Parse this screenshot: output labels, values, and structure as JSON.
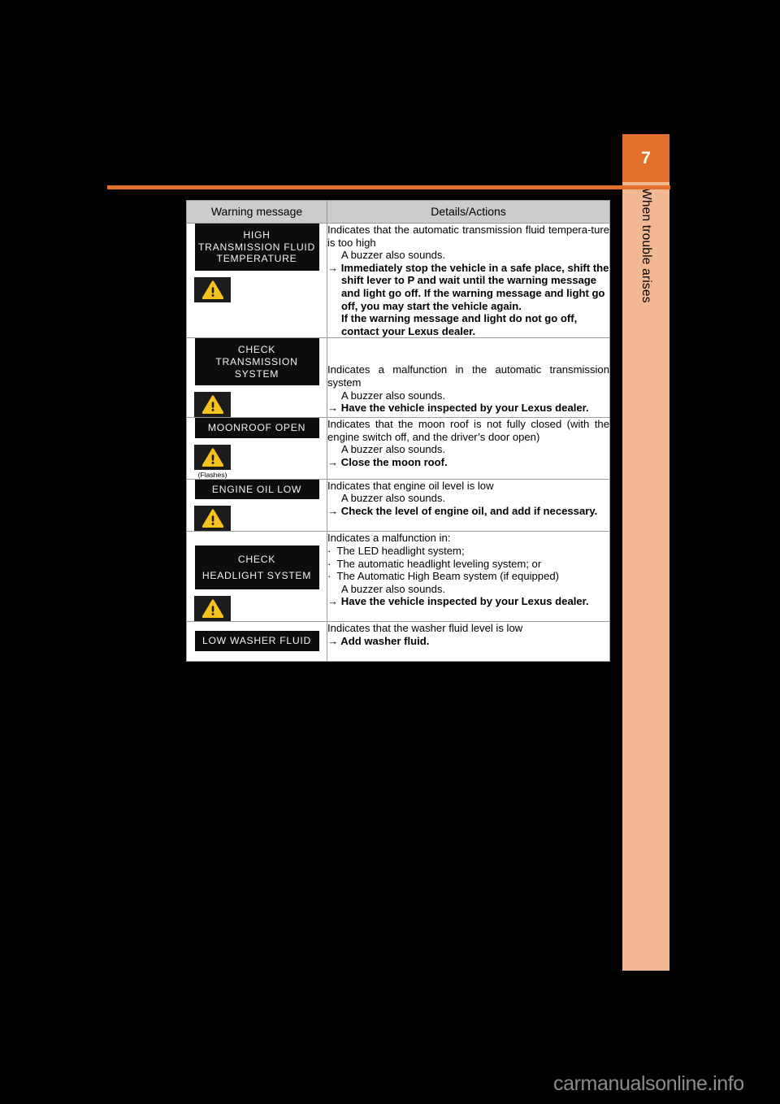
{
  "page": {
    "background_color": "#000000",
    "accent_color": "#e2702a",
    "tab_color": "#f2b894"
  },
  "side_tab": {
    "chapter_number": "7",
    "chapter_label": "When trouble arises"
  },
  "table": {
    "headers": {
      "warning_message": "Warning message",
      "details_actions": "Details/Actions"
    },
    "rows": [
      {
        "display_lines": [
          "HIGH",
          "TRANSMISSION FLUID",
          "TEMPERATURE"
        ],
        "lamp": "warning-triangle-icon",
        "flashes_note": "",
        "description": "Indicates that the automatic transmission fluid tempera-ture is too high",
        "buzzer": "A buzzer also sounds.",
        "arrow": "→",
        "action": "Immediately stop the vehicle in a safe place, shift the shift lever to P and wait until the warning message and light go off. If the warning message and light go off, you may start the vehicle again.",
        "action_extra": "If the warning message and light do not go off, contact your Lexus dealer.",
        "bullets": []
      },
      {
        "display_lines": [
          "CHECK",
          "TRANSMISSION",
          "SYSTEM"
        ],
        "lamp": "warning-triangle-icon",
        "flashes_note": "",
        "description": "Indicates a malfunction in the automatic transmission system",
        "buzzer": "A buzzer also sounds.",
        "arrow": "→",
        "action": "Have the vehicle inspected by your Lexus dealer.",
        "action_extra": "",
        "bullets": []
      },
      {
        "display_lines": [
          "MOONROOF OPEN"
        ],
        "lamp": "warning-triangle-icon",
        "flashes_note": "(Flashes)",
        "description": "Indicates that the moon roof is not fully closed (with the engine switch off, and the driver’s door open)",
        "buzzer": "A buzzer also sounds.",
        "arrow": "→",
        "action": "Close the moon roof.",
        "action_extra": "",
        "bullets": []
      },
      {
        "display_lines": [
          "ENGINE OIL LOW"
        ],
        "lamp": "warning-triangle-icon",
        "flashes_note": "",
        "description": "Indicates that engine oil level is low",
        "buzzer": "A buzzer also sounds.",
        "arrow": "→",
        "action": "Check the level of engine oil, and add if necessary.",
        "action_extra": "",
        "bullets": []
      },
      {
        "display_lines": [
          "CHECK",
          "HEADLIGHT SYSTEM"
        ],
        "lamp": "warning-triangle-icon",
        "flashes_note": "",
        "description": "Indicates a malfunction in:",
        "buzzer": "A buzzer also sounds.",
        "arrow": "→",
        "action": "Have the vehicle inspected by your Lexus dealer.",
        "action_extra": "",
        "bullets": [
          "The LED headlight system;",
          "The automatic headlight leveling system; or",
          "The Automatic High Beam system (if equipped)"
        ],
        "bullet_dot": "·"
      },
      {
        "display_lines": [
          "LOW WASHER FLUID"
        ],
        "lamp": "",
        "flashes_note": "",
        "description": "Indicates that the washer fluid level is low",
        "buzzer": "",
        "arrow": "→",
        "action": "Add washer fluid.",
        "action_extra": "",
        "bullets": []
      }
    ]
  },
  "footer": {
    "watermark": "carmanualsonline.info"
  }
}
